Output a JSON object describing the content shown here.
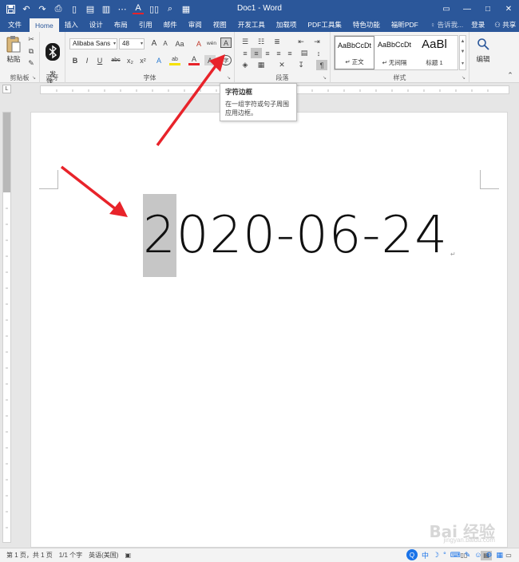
{
  "window": {
    "title": "Doc1 - Word",
    "controls": {
      "restore": "▭",
      "minimize": "—",
      "maximize": "□",
      "close": "✕"
    }
  },
  "qat": {
    "icons": [
      "save-icon",
      "undo-icon",
      "redo-icon",
      "print-preview-icon",
      "new-doc-icon",
      "paste-icon",
      "format-icon",
      "more-icon",
      "font-color-icon",
      "columns-icon",
      "find-icon",
      "table-icon"
    ]
  },
  "tabs": [
    {
      "label": "文件",
      "active": false
    },
    {
      "label": "Home",
      "active": true
    },
    {
      "label": "插入",
      "active": false
    },
    {
      "label": "设计",
      "active": false
    },
    {
      "label": "布局",
      "active": false
    },
    {
      "label": "引用",
      "active": false
    },
    {
      "label": "邮件",
      "active": false
    },
    {
      "label": "审阅",
      "active": false
    },
    {
      "label": "视图",
      "active": false
    },
    {
      "label": "开发工具",
      "active": false
    },
    {
      "label": "加载项",
      "active": false
    },
    {
      "label": "PDF工具集",
      "active": false
    },
    {
      "label": "特色功能",
      "active": false
    },
    {
      "label": "福昕PDF",
      "active": false
    }
  ],
  "tellme": "♀ 告诉我...",
  "account": {
    "login": "登录",
    "share": "共享"
  },
  "ribbon": {
    "clipboard": {
      "paste": "粘贴",
      "label": "剪贴板"
    },
    "bluetooth": {
      "send": "发\n送...",
      "label": "蓝牙"
    },
    "font": {
      "name": "Alibaba Sans",
      "size": "48",
      "label": "字体",
      "bold": "B",
      "italic": "I",
      "underline": "U",
      "strike": "abc",
      "sub": "x₂",
      "sup": "x²",
      "grow": "A",
      "shrink": "A",
      "case": "Aa",
      "clear": "A",
      "pinyin": "wén",
      "border": "A",
      "effects": "A",
      "highlight": "ab",
      "color": "A",
      "shade": "A",
      "enclose": "字"
    },
    "paragraph": {
      "label": "段落"
    },
    "styles": {
      "label": "样式",
      "items": [
        {
          "sample": "AaBbCcDt",
          "name": "↵ 正文",
          "selected": true
        },
        {
          "sample": "AaBbCcDt",
          "name": "↵ 无间隔",
          "selected": false
        },
        {
          "sample": "AaBl",
          "name": "标题 1",
          "selected": false
        }
      ]
    },
    "editing": {
      "label": "编辑"
    }
  },
  "tooltip": {
    "title": "字符边框",
    "body": "在一组字符或句子周围应用边框。"
  },
  "document": {
    "highlighted_char": "2",
    "rest_text": "020-06-24",
    "paragraph_mark": "↵"
  },
  "status": {
    "page": "第 1 页，共 1 页",
    "words": "1/1 个字",
    "language": "英语(美国)"
  },
  "ime": {
    "items": [
      "中",
      "☽",
      "°",
      "⌨",
      "✎",
      "☺",
      "⚙",
      "▦"
    ]
  },
  "watermark": {
    "text": "Bai 经验",
    "sub": "jingyan.baidu.com"
  },
  "colors": {
    "titlebar": "#2b579a",
    "ribbon": "#f3f3f3",
    "arrow": "#e8232a",
    "highlight": "#c6c6c6"
  }
}
